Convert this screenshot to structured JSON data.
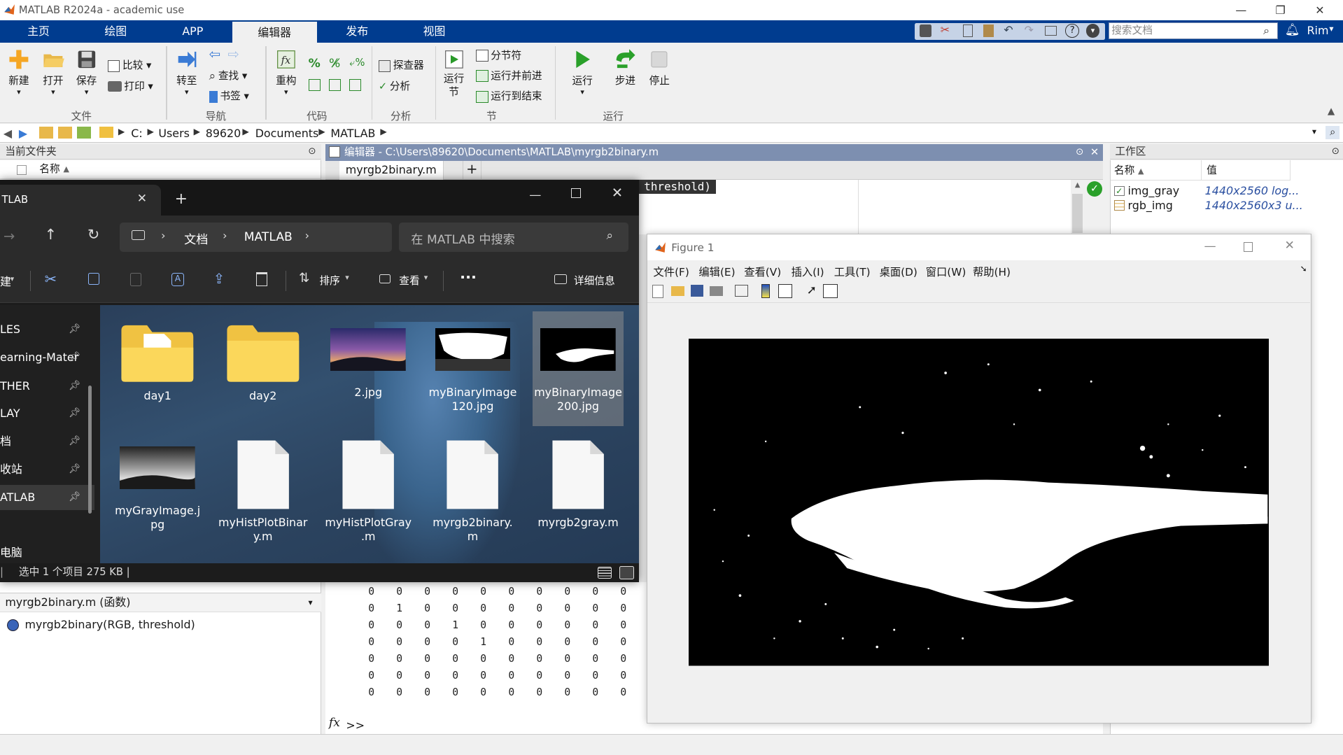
{
  "window": {
    "title": "MATLAB R2024a - academic use"
  },
  "ribbon_tabs": [
    "主页",
    "绘图",
    "APP",
    "编辑器",
    "发布",
    "视图"
  ],
  "active_tab": "编辑器",
  "search": {
    "placeholder": "搜索文档"
  },
  "user": "Rim",
  "ribbon": {
    "file": {
      "new": "新建",
      "open": "打开",
      "save": "保存",
      "compare": "比较",
      "print": "打印",
      "group": "文件"
    },
    "nav": {
      "goto": "转至",
      "find": "查找",
      "bookmark": "书签",
      "group": "导航"
    },
    "code": {
      "refactor": "重构",
      "group": "代码"
    },
    "analyze": {
      "profiler": "探查器",
      "analyze": "分析",
      "group": "分析"
    },
    "section": {
      "run_section": "运行\n节",
      "section_break": "分节符",
      "run_advance": "运行并前进",
      "run_to_end": "运行到结束",
      "group": "节"
    },
    "run": {
      "run": "运行",
      "step": "步进",
      "stop": "停止",
      "group": "运行"
    }
  },
  "address": [
    "C:",
    "Users",
    "89620",
    "Documents",
    "MATLAB"
  ],
  "current_folder": {
    "title": "当前文件夹",
    "col_name": "名称"
  },
  "editor": {
    "title": "编辑器 - C:\\Users\\89620\\Documents\\MATLAB\\myrgb2binary.m",
    "tab": "myrgb2binary.m",
    "snippet": "threshold)"
  },
  "workspace": {
    "title": "工作区",
    "col_name": "名称",
    "col_value": "值",
    "vars": [
      {
        "name": "img_gray",
        "value": "1440x2560 log..."
      },
      {
        "name": "rgb_img",
        "value": "1440x2560x3 u..."
      }
    ]
  },
  "explorer": {
    "tab_title": "TLAB",
    "new_tab": "+",
    "crumbs": [
      "文档",
      "MATLAB"
    ],
    "search_placeholder": "在 MATLAB 中搜索",
    "cmd_sort": "排序",
    "cmd_view": "查看",
    "cmd_more": "···",
    "cmd_details": "详细信息",
    "cmd_new": "建",
    "sidebar": [
      "LES",
      "earning-Mater",
      "THER",
      "LAY",
      "档",
      "收站",
      "ATLAB",
      "电脑"
    ],
    "files": [
      {
        "name": "day1",
        "kind": "folder-doc"
      },
      {
        "name": "day2",
        "kind": "folder"
      },
      {
        "name": "2.jpg",
        "kind": "img-color"
      },
      {
        "name": "myBinaryImage\n120.jpg",
        "kind": "img-bin1"
      },
      {
        "name": "myBinaryImage\n200.jpg",
        "kind": "img-bin2"
      },
      {
        "name": "myGrayImage.j\npg",
        "kind": "img-gray"
      },
      {
        "name": "myHistPlotBinar\ny.m",
        "kind": "doc"
      },
      {
        "name": "myHistPlotGray\n.m",
        "kind": "doc"
      },
      {
        "name": "myrgb2binary.\nm",
        "kind": "doc"
      },
      {
        "name": "myrgb2gray.m",
        "kind": "doc"
      }
    ],
    "status": "选中 1 个项目  275 KB  |"
  },
  "details_panel": {
    "file": "myrgb2binary.m  (函数)",
    "signature": "myrgb2binary(RGB, threshold)"
  },
  "command_window": {
    "matrix": [
      [
        0,
        0,
        0,
        0,
        0,
        0,
        0,
        0,
        0,
        0
      ],
      [
        0,
        1,
        0,
        0,
        0,
        0,
        0,
        0,
        0,
        0
      ],
      [
        0,
        0,
        0,
        1,
        0,
        0,
        0,
        0,
        0,
        0
      ],
      [
        0,
        0,
        0,
        0,
        1,
        0,
        0,
        0,
        0,
        0
      ],
      [
        0,
        0,
        0,
        0,
        0,
        0,
        0,
        0,
        0,
        0
      ],
      [
        0,
        0,
        0,
        0,
        0,
        0,
        0,
        0,
        0,
        0
      ],
      [
        0,
        0,
        0,
        0,
        0,
        0,
        0,
        0,
        0,
        0
      ]
    ],
    "prompt": ">>",
    "fx": "fx"
  },
  "figure": {
    "title": "Figure 1",
    "menu": [
      "文件(F)",
      "编辑(E)",
      "查看(V)",
      "插入(I)",
      "工具(T)",
      "桌面(D)",
      "窗口(W)",
      "帮助(H)"
    ]
  }
}
